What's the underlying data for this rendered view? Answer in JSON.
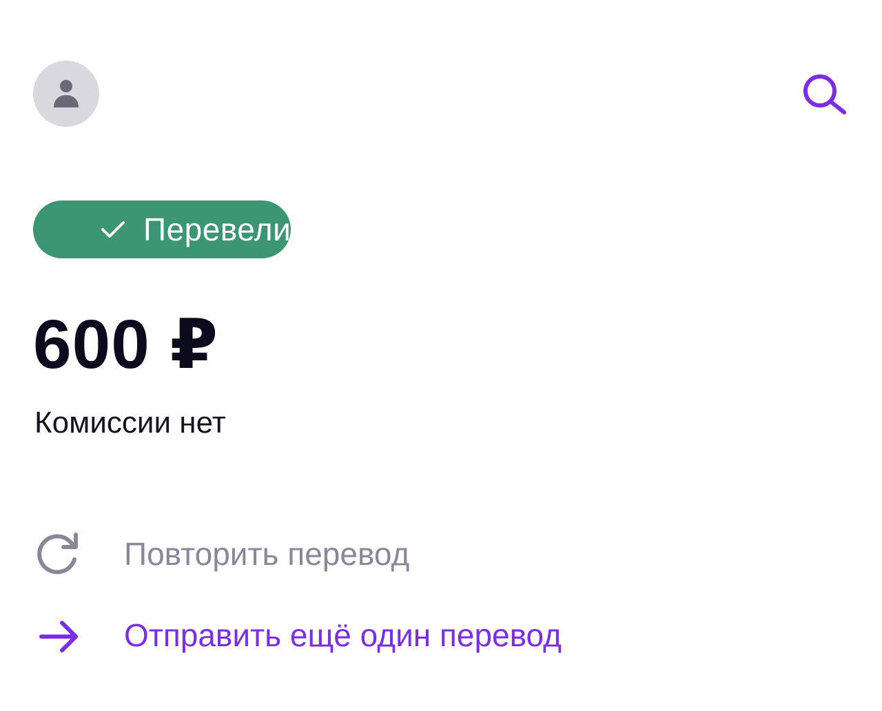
{
  "header": {
    "avatar_icon": "person-icon",
    "search_icon": "search-icon"
  },
  "status": {
    "label": "Перевели",
    "icon": "check-icon",
    "color": "#3c9673"
  },
  "amount": {
    "value": "600 ₽"
  },
  "fee": {
    "text": "Комиссии нет"
  },
  "actions": {
    "repeat": {
      "label": "Повторить перевод",
      "icon": "refresh-icon",
      "color": "#8a8898"
    },
    "send_another": {
      "label": "Отправить ещё один перевод",
      "icon": "arrow-right-icon",
      "color": "#7a2fe6"
    }
  },
  "colors": {
    "accent": "#7a2fe6",
    "avatar_bg": "#d9d8de",
    "text_primary": "#0c0b1e"
  }
}
